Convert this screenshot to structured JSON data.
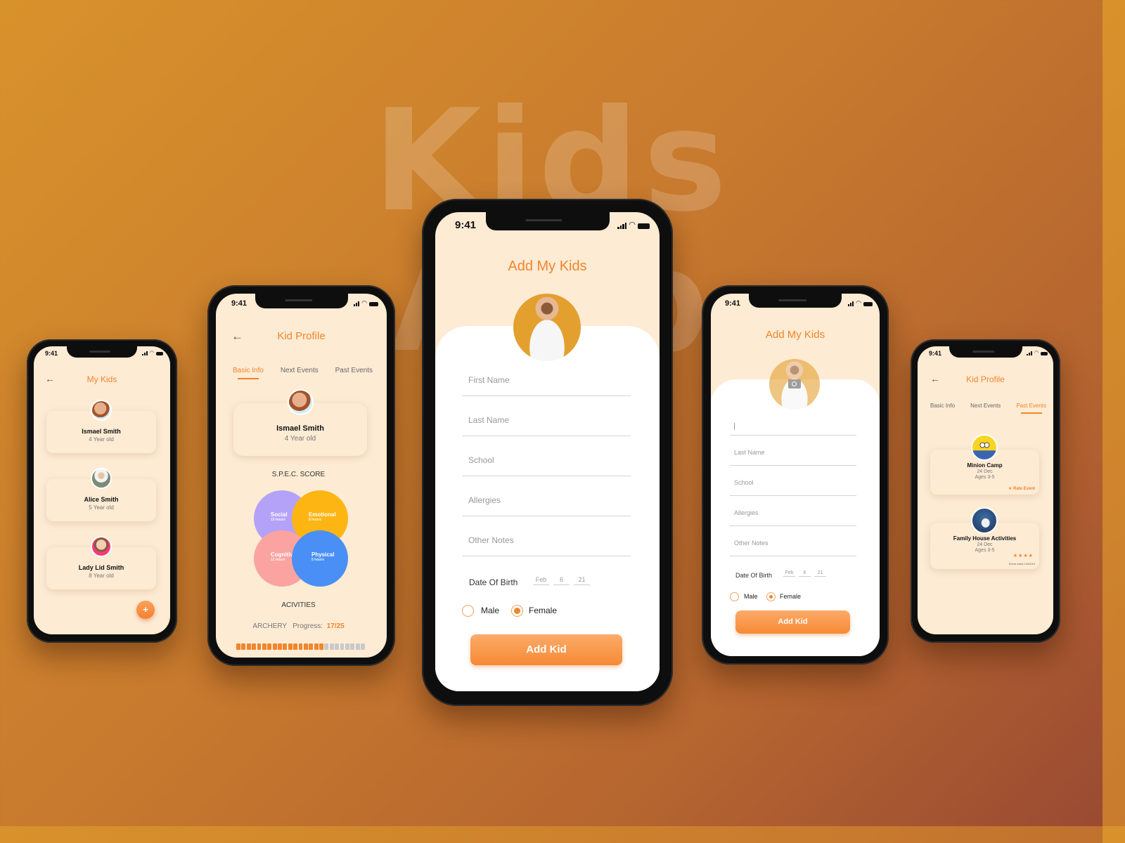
{
  "hero": {
    "title": "Kids App"
  },
  "colors": {
    "accent": "#f1852b",
    "screen_bg": "#fdebd4",
    "social": "#b4a2f8",
    "emotional": "#fcb512",
    "cognitive": "#fba3a0",
    "physical": "#4a8ff5"
  },
  "status_bar": {
    "time": "9:41"
  },
  "phone_my_kids": {
    "title": "My Kids",
    "back_icon": "arrow-left-icon",
    "kids": [
      {
        "name": "Ismael Smith",
        "age": "4 Year old"
      },
      {
        "name": "Alice Smith",
        "age": "5 Year old"
      },
      {
        "name": "Lady Lid Smith",
        "age": "8 Year old"
      }
    ],
    "fab_label": "+"
  },
  "phone_kid_profile": {
    "title": "Kid Profile",
    "tabs": [
      "Basic Info",
      "Next Events",
      "Past Events"
    ],
    "active_tab": "Basic Info",
    "kid": {
      "name": "Ismael Smith",
      "age": "4 Year old"
    },
    "spec_title": "S.P.E.C. SCORE",
    "spec": [
      {
        "label": "Social",
        "hours": "15 hours"
      },
      {
        "label": "Emotional",
        "hours": "8 hours"
      },
      {
        "label": "Cognitive",
        "hours": "12 hours"
      },
      {
        "label": "Physical",
        "hours": "5 hours"
      }
    ],
    "activities_title": "ACIVITIES",
    "activity": {
      "name": "ARCHERY",
      "progress_label": "Progress:",
      "progress_text": "17/25",
      "done": 17,
      "total": 25
    }
  },
  "phone_add_kid_main": {
    "title": "Add My Kids",
    "fields": [
      "First Name",
      "Last Name",
      "School",
      "Allergies",
      "Other Notes"
    ],
    "dob_label": "Date Of Birth",
    "dob": {
      "month": "Feb",
      "day": "6",
      "year": "21"
    },
    "gender": {
      "male": "Male",
      "female": "Female",
      "selected": "Female"
    },
    "submit": "Add Kid"
  },
  "phone_add_kid_edit": {
    "title": "Add My Kids",
    "camera_icon": "camera-icon",
    "first_name_value": "",
    "fields": [
      "Last Name",
      "School",
      "Allergies",
      "Other Notes"
    ],
    "dob_label": "Date Of Birth",
    "dob": {
      "month": "Feb",
      "day": "6",
      "year": "21"
    },
    "gender": {
      "male": "Male",
      "female": "Female",
      "selected": "Female"
    },
    "submit": "Add Kid"
  },
  "phone_past_events": {
    "title": "Kid Profile",
    "tabs": [
      "Basic Info",
      "Next Events",
      "Past Events"
    ],
    "active_tab": "Past Events",
    "events": [
      {
        "name": "Minion Camp",
        "date": "24 Dec",
        "ages": "Ages 3-5",
        "action": "Rate Event"
      },
      {
        "name": "Family House Activities",
        "date": "24 Dec",
        "ages": "Ages 3-5",
        "rating": 4,
        "rated_text": "Event rated 14/03/19"
      }
    ]
  }
}
